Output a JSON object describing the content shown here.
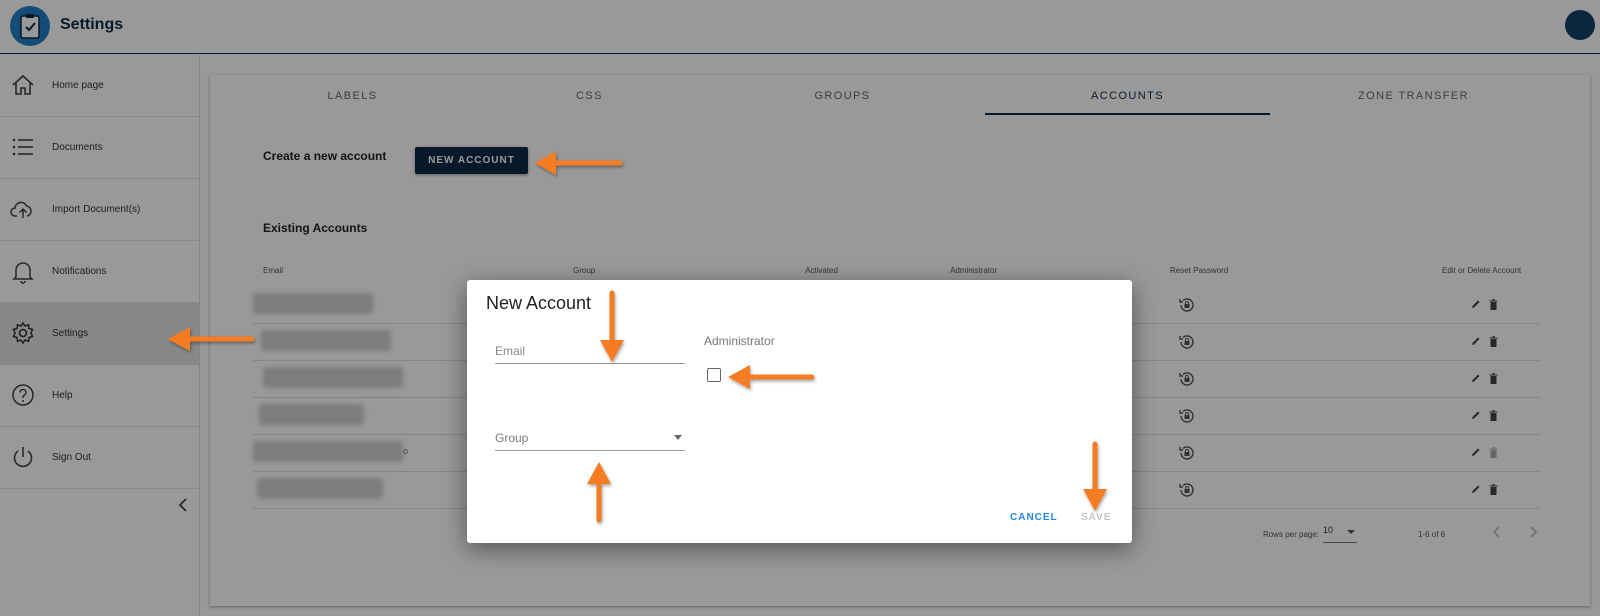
{
  "app": {
    "title": "Settings"
  },
  "sidebar": {
    "items": [
      {
        "label": "Home page",
        "icon": "home-icon"
      },
      {
        "label": "Documents",
        "icon": "list-icon"
      },
      {
        "label": "Import Document(s)",
        "icon": "cloud-upload-icon"
      },
      {
        "label": "Notifications",
        "icon": "bell-icon"
      },
      {
        "label": "Settings",
        "icon": "gear-icon",
        "active": true
      },
      {
        "label": "Help",
        "icon": "help-icon"
      },
      {
        "label": "Sign Out",
        "icon": "power-icon"
      }
    ]
  },
  "tabs": [
    {
      "label": "LABELS"
    },
    {
      "label": "CSS"
    },
    {
      "label": "GROUPS"
    },
    {
      "label": "ACCOUNTS",
      "active": true
    },
    {
      "label": "ZONE TRANSFER"
    }
  ],
  "accounts": {
    "create_label": "Create a new account",
    "new_button": "NEW ACCOUNT",
    "existing_label": "Existing Accounts",
    "columns": [
      "Email",
      "Group",
      "Activated",
      "Administrator",
      "Reset Password",
      "Edit or Delete Account"
    ],
    "row_count": 6,
    "email_suffix_visible": "o"
  },
  "pagination": {
    "rows_per_page_label": "Rows per page:",
    "rows_per_page": "10",
    "range": "1-6 of 6"
  },
  "dialog": {
    "title": "New Account",
    "email_placeholder": "Email",
    "administrator_label": "Administrator",
    "group_placeholder": "Group",
    "cancel": "CANCEL",
    "save": "SAVE"
  },
  "colors": {
    "primary": "#0d2a45",
    "accent_link": "#1e88e5",
    "annotation_arrow": "#f57c20",
    "overlay": "rgba(0,0,0,0.4)"
  }
}
